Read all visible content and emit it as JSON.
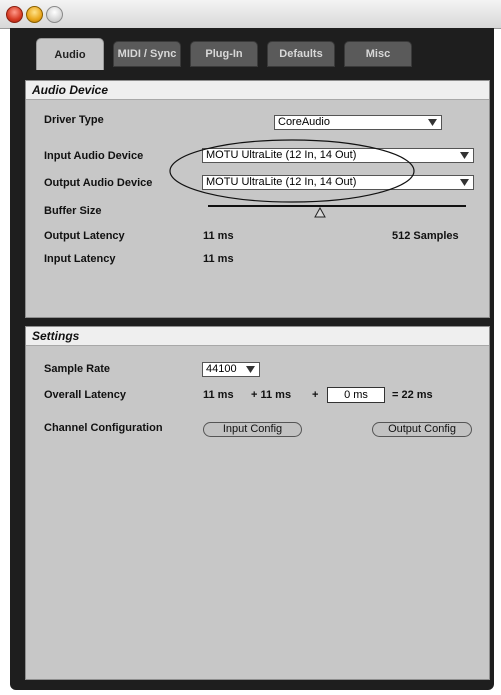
{
  "tabs": [
    {
      "label": "Audio",
      "active": true
    },
    {
      "label": "MIDI / Sync",
      "active": false
    },
    {
      "label": "Plug-In",
      "active": false
    },
    {
      "label": "Defaults",
      "active": false
    },
    {
      "label": "Misc",
      "active": false
    }
  ],
  "audio_device": {
    "title": "Audio Device",
    "driver_type_label": "Driver Type",
    "driver_type_value": "CoreAudio",
    "input_device_label": "Input Audio Device",
    "input_device_value": "MOTU UltraLite (12 In, 14 Out)",
    "output_device_label": "Output Audio Device",
    "output_device_value": "MOTU UltraLite (12 In, 14 Out)",
    "buffer_size_label": "Buffer Size",
    "output_latency_label": "Output Latency",
    "output_latency_value": "11 ms",
    "samples_value": "512 Samples",
    "input_latency_label": "Input Latency",
    "input_latency_value": "11 ms"
  },
  "settings": {
    "title": "Settings",
    "sample_rate_label": "Sample Rate",
    "sample_rate_value": "44100",
    "overall_latency_label": "Overall Latency",
    "overall_latency_part1": "11 ms",
    "overall_latency_part2": "+ 11 ms",
    "plus_sign": "+",
    "overall_latency_offset": "0 ms",
    "overall_latency_total": "= 22 ms",
    "channel_config_label": "Channel Configuration",
    "input_config_button": "Input Config",
    "output_config_button": "Output Config"
  },
  "icons": {
    "close": "close-icon",
    "minimize": "minimize-icon",
    "zoom": "zoom-icon",
    "dropdown": "triangle-down-icon",
    "slider_handle": "triangle-up-icon"
  },
  "colors": {
    "panel_bg": "#c7c7c7",
    "window_bg": "#1e1e1e",
    "header_bg": "#efefef"
  }
}
